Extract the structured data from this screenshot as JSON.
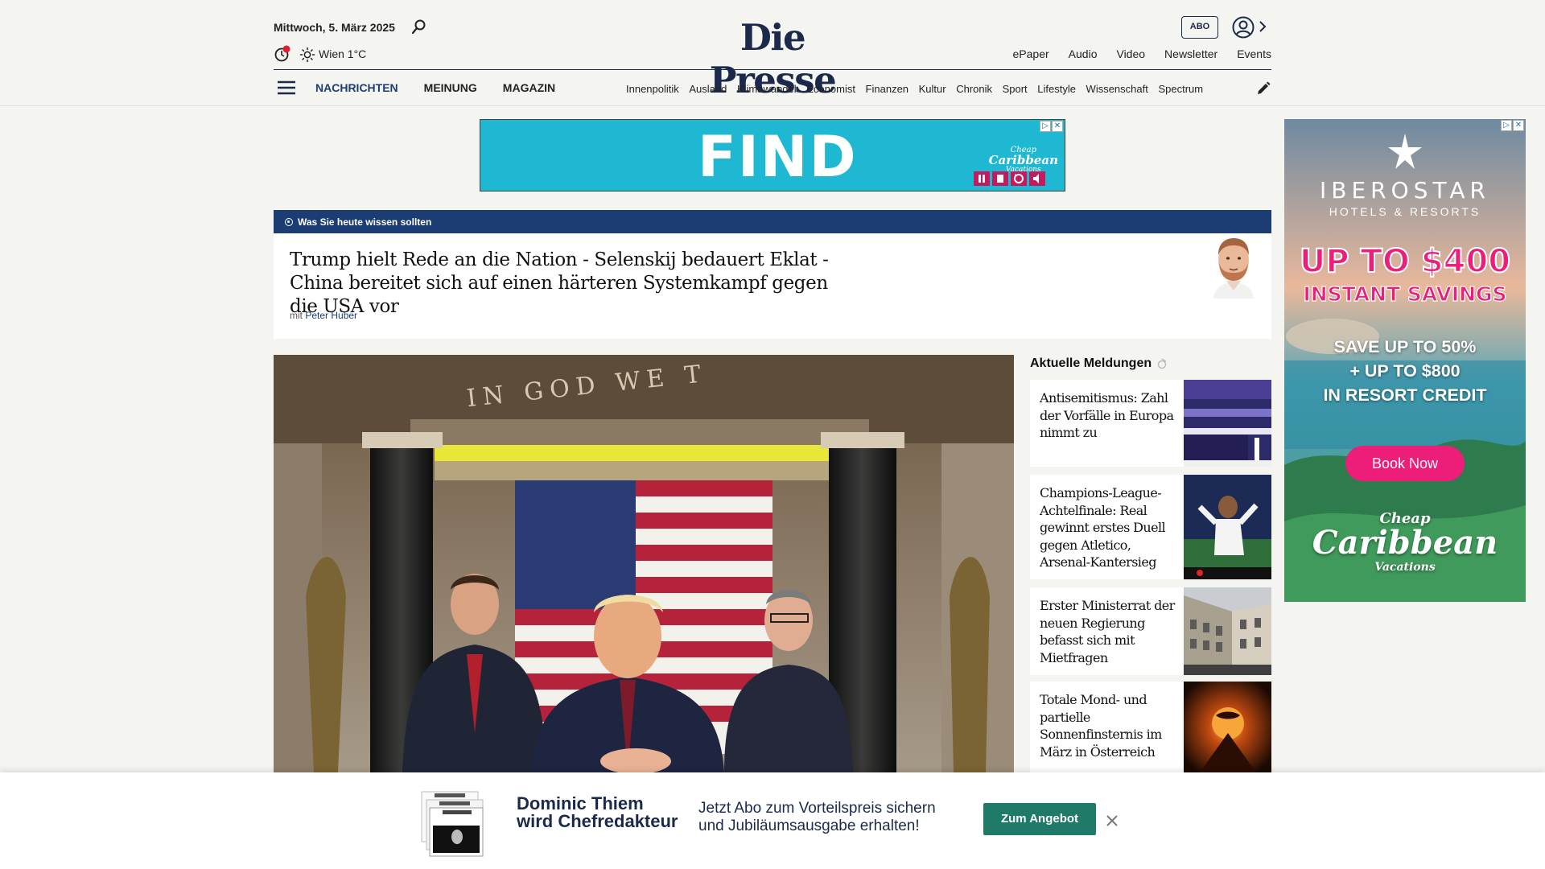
{
  "header": {
    "date": "Mittwoch, 5. März 2025",
    "weather": "Wien 1°C",
    "logo": "Die Presse",
    "abo_label": "ABO",
    "top_links": [
      "ePaper",
      "Audio",
      "Video",
      "Newsletter",
      "Events"
    ],
    "main_nav": [
      "NACHRICHTEN",
      "MEINUNG",
      "MAGAZIN"
    ],
    "sub_nav": [
      "Innenpolitik",
      "Ausland",
      "Klimawandel",
      "Economist",
      "Finanzen",
      "Kultur",
      "Chronik",
      "Sport",
      "Lifestyle",
      "Wissenschaft",
      "Spectrum"
    ]
  },
  "ad_top": {
    "headline": "FIND",
    "brand_line1": "Cheap",
    "brand_line2": "Caribbean",
    "brand_line3": "Vacations"
  },
  "briefing": {
    "label": "Was Sie heute wissen sollten",
    "title": "Trump hielt Rede an die Nation - Selenskij bedauert Eklat - China bereitet sich auf einen härteren Systemkampf gegen die USA vor",
    "author_prefix": "mit",
    "author": "Peter Huber"
  },
  "hero": {
    "inscription": "IN GOD WE T"
  },
  "news": {
    "heading": "Aktuelle Meldungen",
    "items": [
      {
        "title": "Antisemitismus: Zahl der Vorfälle in Europa nimmt zu"
      },
      {
        "title": "Champions-League-Achtelfinale: Real gewinnt erstes Duell gegen Atletico, Arsenal-Kantersieg"
      },
      {
        "title": "Erster Ministerrat der neuen Regierung befasst sich mit Mietfragen"
      },
      {
        "title": "Totale Mond- und partielle Sonnenfinsternis im März in Österreich"
      }
    ]
  },
  "ad_side": {
    "brand": "IBEROSTAR",
    "brand_sub": "HOTELS & RESORTS",
    "headline1": "UP TO $400",
    "headline2": "INSTANT SAVINGS",
    "save_line1": "SAVE UP TO 50%",
    "save_line2": "+ UP TO $800",
    "save_line3": "IN RESORT CREDIT",
    "cta": "Book Now",
    "logo_line1": "Cheap",
    "logo_line2": "Caribbean",
    "logo_line3": "Vacations"
  },
  "promo": {
    "name_line1": "Dominic Thiem",
    "name_line2": "wird Chefredakteur",
    "text_line1": "Jetzt Abo zum Vorteilspreis sichern",
    "text_line2": "und Jubiläumsausgabe erhalten!",
    "button": "Zum Angebot"
  },
  "colors": {
    "brand_navy": "#1b2a4a",
    "nav_blue": "#1b3d74",
    "ad_cyan": "#1fb8d2",
    "ad_pink": "#ec1e7a",
    "promo_green": "#1f7a67"
  }
}
